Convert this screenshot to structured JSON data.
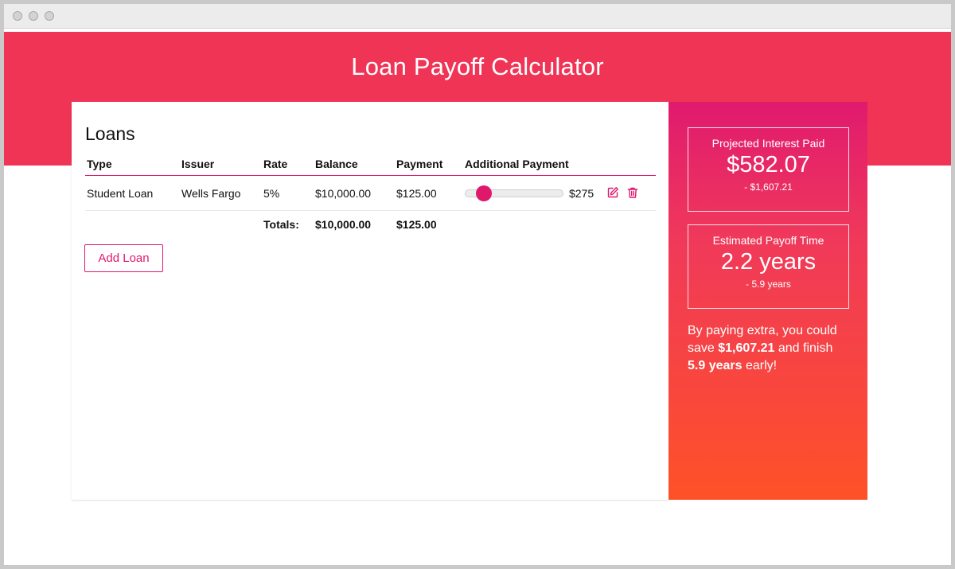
{
  "app": {
    "title": "Loan Payoff Calculator"
  },
  "loans": {
    "heading": "Loans",
    "columns": [
      "Type",
      "Issuer",
      "Rate",
      "Balance",
      "Payment",
      "Additional Payment"
    ],
    "rows": [
      {
        "type": "Student Loan",
        "issuer": "Wells Fargo",
        "rate": "5%",
        "balance": "$10,000.00",
        "payment": "$125.00",
        "additional_payment": "$275"
      }
    ],
    "totals": {
      "label": "Totals:",
      "balance": "$10,000.00",
      "payment": "$125.00"
    },
    "add_button": "Add Loan"
  },
  "summary": {
    "interest": {
      "label": "Projected Interest Paid",
      "value": "$582.07",
      "delta": "- $1,607.21"
    },
    "payoff": {
      "label": "Estimated Payoff Time",
      "value": "2.2 years",
      "delta": "- 5.9 years"
    },
    "message": {
      "p1": "By paying extra, you could save ",
      "savings": "$1,607.21",
      "p2": " and finish ",
      "time": "5.9 years",
      "p3": " early!"
    }
  },
  "icons": {
    "edit": "edit-icon",
    "delete": "trash-icon"
  },
  "colors": {
    "header": "#f03456",
    "accent": "#e0186c",
    "gradient_start": "#e01a6f",
    "gradient_end": "#ff5127"
  }
}
